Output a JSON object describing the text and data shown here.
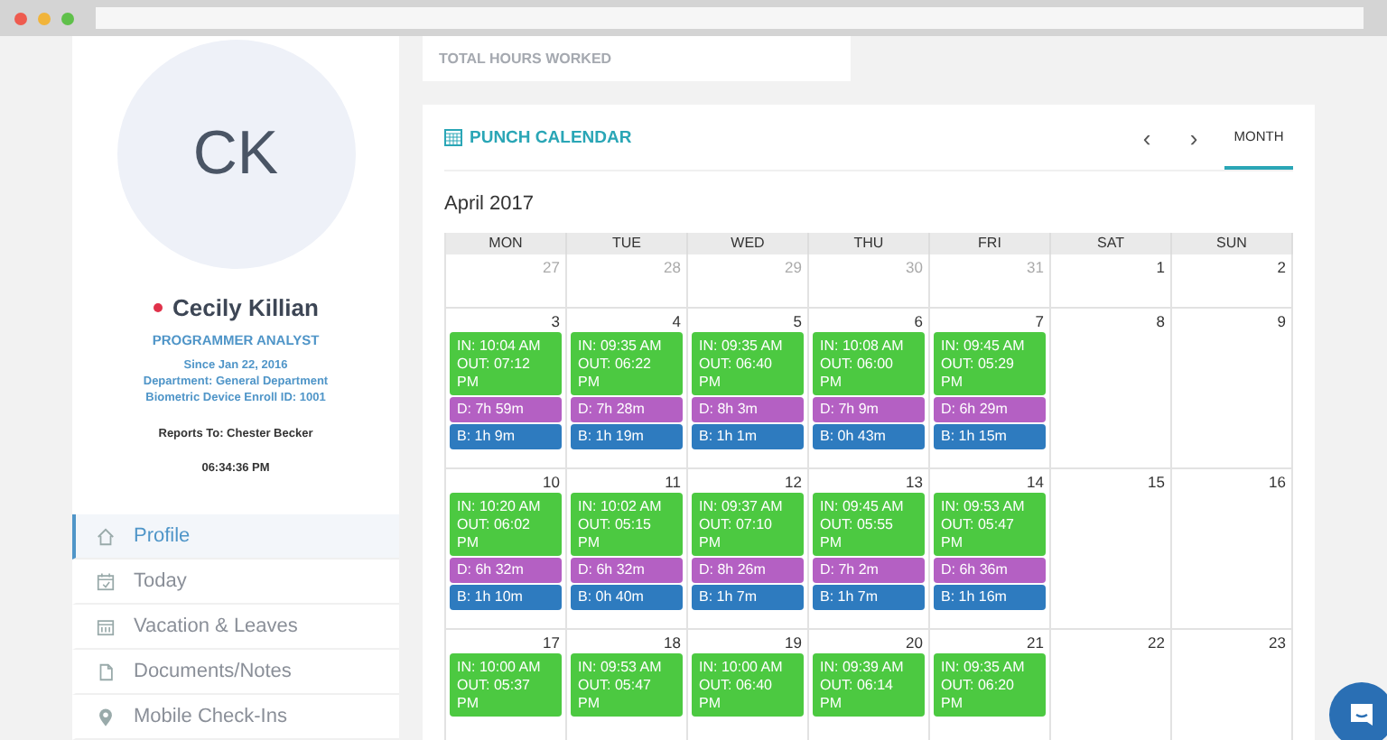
{
  "profile": {
    "initials": "CK",
    "name": "Cecily Killian",
    "online": false,
    "title": "PROGRAMMER ANALYST",
    "details": [
      "Since Jan 22, 2016",
      "Department: General Department",
      "Biometric Device Enroll ID: 1001"
    ],
    "reports_to": "Reports To: Chester Becker",
    "clock": "06:34:36 PM"
  },
  "menu": [
    {
      "label": "Profile",
      "kind": "home",
      "selected": true
    },
    {
      "label": "Today",
      "kind": "calendar",
      "selected": false
    },
    {
      "label": "Vacation & Leaves",
      "kind": "grid",
      "selected": false
    },
    {
      "label": "Documents/Notes",
      "kind": "document",
      "selected": false
    },
    {
      "label": "Mobile Check-Ins",
      "kind": "pin",
      "selected": false
    }
  ],
  "total_hours": {
    "label": "TOTAL HOURS WORKED"
  },
  "calendar": {
    "title": "PUNCH CALENDAR",
    "prev": "‹",
    "next": "›",
    "views": [
      {
        "label": "MONTH",
        "selected": true
      }
    ],
    "month": "April 2017",
    "weekdays": [
      "MON",
      "TUE",
      "WED",
      "THU",
      "FRI",
      "SAT",
      "SUN"
    ],
    "weeks": [
      [
        {
          "day": "27",
          "muted": true
        },
        {
          "day": "28",
          "muted": true
        },
        {
          "day": "29",
          "muted": true
        },
        {
          "day": "30",
          "muted": true
        },
        {
          "day": "31",
          "muted": true
        },
        {
          "day": "1",
          "muted": false
        },
        {
          "day": "2",
          "muted": false
        }
      ],
      [
        {
          "day": "3",
          "muted": false,
          "entries": [
            {
              "kind": "punch",
              "text": "IN: 10:04 AM OUT: 07:12 PM"
            },
            {
              "kind": "duration",
              "text": "D: 7h 59m"
            },
            {
              "kind": "break",
              "text": "B: 1h 9m"
            }
          ]
        },
        {
          "day": "4",
          "muted": false,
          "entries": [
            {
              "kind": "punch",
              "text": "IN: 09:35 AM OUT: 06:22 PM"
            },
            {
              "kind": "duration",
              "text": "D: 7h 28m"
            },
            {
              "kind": "break",
              "text": "B: 1h 19m"
            }
          ]
        },
        {
          "day": "5",
          "muted": false,
          "entries": [
            {
              "kind": "punch",
              "text": "IN: 09:35 AM OUT: 06:40 PM"
            },
            {
              "kind": "duration",
              "text": "D: 8h 3m"
            },
            {
              "kind": "break",
              "text": "B: 1h 1m"
            }
          ]
        },
        {
          "day": "6",
          "muted": false,
          "entries": [
            {
              "kind": "punch",
              "text": "IN: 10:08 AM OUT: 06:00 PM"
            },
            {
              "kind": "duration",
              "text": "D: 7h 9m"
            },
            {
              "kind": "break",
              "text": "B: 0h 43m"
            }
          ]
        },
        {
          "day": "7",
          "muted": false,
          "entries": [
            {
              "kind": "punch",
              "text": "IN: 09:45 AM OUT: 05:29 PM"
            },
            {
              "kind": "duration",
              "text": "D: 6h 29m"
            },
            {
              "kind": "break",
              "text": "B: 1h 15m"
            }
          ]
        },
        {
          "day": "8",
          "muted": false
        },
        {
          "day": "9",
          "muted": false
        }
      ],
      [
        {
          "day": "10",
          "muted": false,
          "entries": [
            {
              "kind": "punch",
              "text": "IN: 10:20 AM OUT: 06:02 PM"
            },
            {
              "kind": "duration",
              "text": "D: 6h 32m"
            },
            {
              "kind": "break",
              "text": "B: 1h 10m"
            }
          ]
        },
        {
          "day": "11",
          "muted": false,
          "entries": [
            {
              "kind": "punch",
              "text": "IN: 10:02 AM OUT: 05:15 PM"
            },
            {
              "kind": "duration",
              "text": "D: 6h 32m"
            },
            {
              "kind": "break",
              "text": "B: 0h 40m"
            }
          ]
        },
        {
          "day": "12",
          "muted": false,
          "entries": [
            {
              "kind": "punch",
              "text": "IN: 09:37 AM OUT: 07:10 PM"
            },
            {
              "kind": "duration",
              "text": "D: 8h 26m"
            },
            {
              "kind": "break",
              "text": "B: 1h 7m"
            }
          ]
        },
        {
          "day": "13",
          "muted": false,
          "entries": [
            {
              "kind": "punch",
              "text": "IN: 09:45 AM OUT: 05:55 PM"
            },
            {
              "kind": "duration",
              "text": "D: 7h 2m"
            },
            {
              "kind": "break",
              "text": "B: 1h 7m"
            }
          ]
        },
        {
          "day": "14",
          "muted": false,
          "entries": [
            {
              "kind": "punch",
              "text": "IN: 09:53 AM OUT: 05:47 PM"
            },
            {
              "kind": "duration",
              "text": "D: 6h 36m"
            },
            {
              "kind": "break",
              "text": "B: 1h 16m"
            }
          ]
        },
        {
          "day": "15",
          "muted": false
        },
        {
          "day": "16",
          "muted": false
        }
      ],
      [
        {
          "day": "17",
          "muted": false,
          "entries": [
            {
              "kind": "punch",
              "text": "IN: 10:00 AM OUT: 05:37 PM"
            }
          ]
        },
        {
          "day": "18",
          "muted": false,
          "entries": [
            {
              "kind": "punch",
              "text": "IN: 09:53 AM OUT: 05:47 PM"
            }
          ]
        },
        {
          "day": "19",
          "muted": false,
          "entries": [
            {
              "kind": "punch",
              "text": "IN: 10:00 AM OUT: 06:40 PM"
            }
          ]
        },
        {
          "day": "20",
          "muted": false,
          "entries": [
            {
              "kind": "punch",
              "text": "IN: 09:39 AM OUT: 06:14 PM"
            }
          ]
        },
        {
          "day": "21",
          "muted": false,
          "entries": [
            {
              "kind": "punch",
              "text": "IN: 09:35 AM OUT: 06:20 PM"
            }
          ]
        },
        {
          "day": "22",
          "muted": false
        },
        {
          "day": "23",
          "muted": false
        }
      ]
    ]
  }
}
